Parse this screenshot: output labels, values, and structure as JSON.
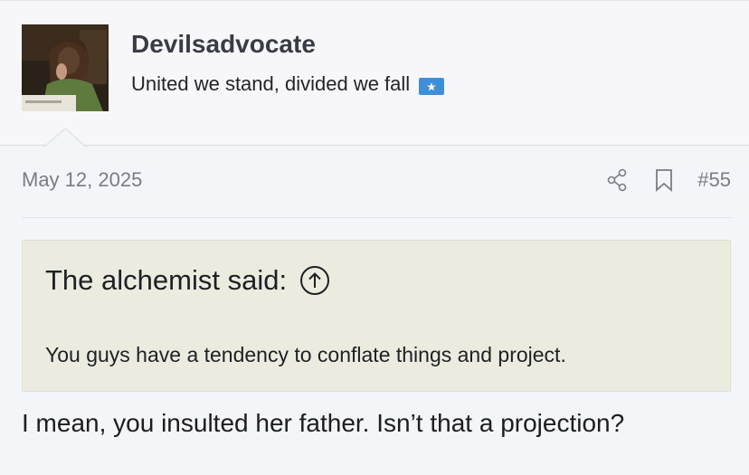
{
  "author": {
    "username": "Devilsadvocate",
    "tagline": "United we stand, divided we fall"
  },
  "post": {
    "date": "May 12, 2025",
    "number": "#55",
    "quote": {
      "header": "The alchemist said:",
      "text": "You guys have a tendency to conflate things and project."
    },
    "body": "I mean, you insulted her father. Isn’t that a projection?"
  },
  "icons": {
    "share": "share-icon",
    "bookmark": "bookmark-icon",
    "expand": "arrow-up-circle-icon",
    "flag": "somalia-flag-icon"
  },
  "colors": {
    "quote_background": "#ecebe0",
    "page_background": "#f4f5f9",
    "muted_text": "#7b7c85"
  }
}
